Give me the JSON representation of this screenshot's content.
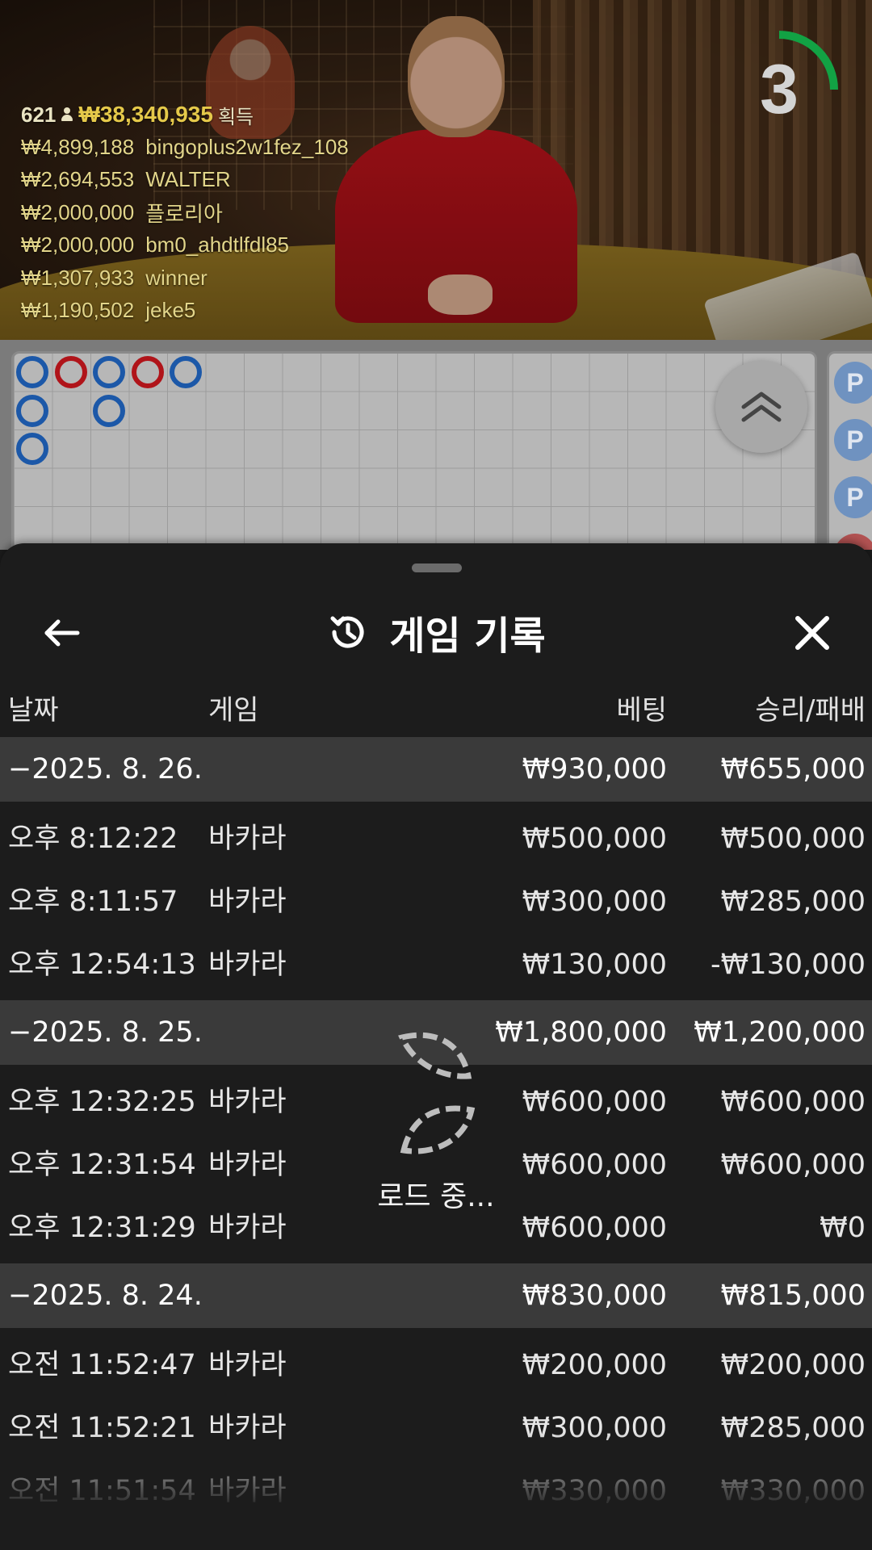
{
  "stream": {
    "winners_count": "621",
    "winners_total": "₩38,340,935",
    "winners_label": "획득",
    "winners": [
      {
        "amount": "₩4,899,188",
        "name": "bingoplus2w1fez_108"
      },
      {
        "amount": "₩2,694,553",
        "name": "WALTER"
      },
      {
        "amount": "₩2,000,000",
        "name": "플로리아"
      },
      {
        "amount": "₩2,000,000",
        "name": "bm0_ahdtlfdl85"
      },
      {
        "amount": "₩1,307,933",
        "name": "winner"
      },
      {
        "amount": "₩1,190,502",
        "name": "jeke5"
      }
    ],
    "countdown": "3",
    "countdown_fraction": 0.25,
    "countdown_color": "#12a244"
  },
  "roadmap": {
    "beads": [
      {
        "col": 0,
        "row": 0,
        "result": "P"
      },
      {
        "col": 0,
        "row": 1,
        "result": "P"
      },
      {
        "col": 0,
        "row": 2,
        "result": "P"
      },
      {
        "col": 1,
        "row": 0,
        "result": "B"
      },
      {
        "col": 2,
        "row": 0,
        "result": "P"
      },
      {
        "col": 2,
        "row": 1,
        "result": "P"
      },
      {
        "col": 3,
        "row": 0,
        "result": "B"
      },
      {
        "col": 4,
        "row": 0,
        "result": "P"
      }
    ],
    "side_beads": [
      {
        "label": "P",
        "result": "P"
      },
      {
        "label": "P",
        "result": "P"
      },
      {
        "label": "P",
        "result": "P"
      },
      {
        "label": "",
        "result": "B"
      }
    ],
    "colors": {
      "player": "#1c58a8",
      "banker": "#b0141a"
    }
  },
  "history": {
    "title": "게임 기록",
    "columns": {
      "date": "날짜",
      "game": "게임",
      "bet": "베팅",
      "result": "승리/패배"
    },
    "groups": [
      {
        "date": "−2025. 8. 26.",
        "bet": "₩930,000",
        "result": "₩655,000",
        "rows": [
          {
            "time": "오후 8:12:22",
            "game": "바카라",
            "bet": "₩500,000",
            "result": "₩500,000"
          },
          {
            "time": "오후 8:11:57",
            "game": "바카라",
            "bet": "₩300,000",
            "result": "₩285,000"
          },
          {
            "time": "오후 12:54:13",
            "game": "바카라",
            "bet": "₩130,000",
            "result": "-₩130,000"
          }
        ]
      },
      {
        "date": "−2025. 8. 25.",
        "bet": "₩1,800,000",
        "result": "₩1,200,000",
        "rows": [
          {
            "time": "오후 12:32:25",
            "game": "바카라",
            "bet": "₩600,000",
            "result": "₩600,000"
          },
          {
            "time": "오후 12:31:54",
            "game": "바카라",
            "bet": "₩600,000",
            "result": "₩600,000"
          },
          {
            "time": "오후 12:31:29",
            "game": "바카라",
            "bet": "₩600,000",
            "result": "₩0"
          }
        ]
      },
      {
        "date": "−2025. 8. 24.",
        "bet": "₩830,000",
        "result": "₩815,000",
        "rows": [
          {
            "time": "오전 11:52:47",
            "game": "바카라",
            "bet": "₩200,000",
            "result": "₩200,000"
          },
          {
            "time": "오전 11:52:21",
            "game": "바카라",
            "bet": "₩300,000",
            "result": "₩285,000"
          },
          {
            "time": "오전 11:51:54",
            "game": "바카라",
            "bet": "₩330,000",
            "result": "₩330,000"
          }
        ]
      }
    ],
    "loading_text": "로드 중..."
  }
}
